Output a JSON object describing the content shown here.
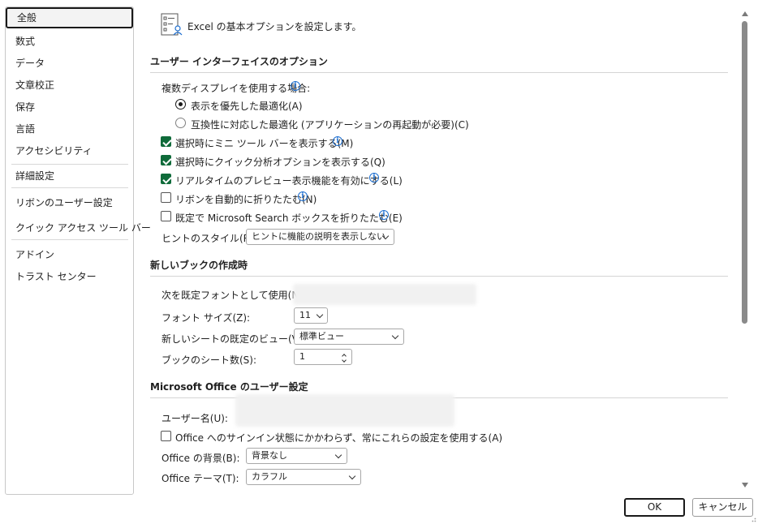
{
  "sidebar": {
    "items": [
      {
        "label": "全般"
      },
      {
        "label": "数式"
      },
      {
        "label": "データ"
      },
      {
        "label": "文章校正"
      },
      {
        "label": "保存"
      },
      {
        "label": "言語"
      },
      {
        "label": "アクセシビリティ"
      },
      {
        "label": "詳細設定"
      },
      {
        "label": "リボンのユーザー設定"
      },
      {
        "label": "クイック アクセス ツール バー"
      },
      {
        "label": "アドイン"
      },
      {
        "label": "トラスト センター"
      }
    ]
  },
  "header": {
    "title": "Excel の基本オプションを設定します。",
    "icon": "options-list-icon"
  },
  "ui_section": {
    "title": "ユーザー インターフェイスのオプション",
    "multi_display_label": "複数ディスプレイを使用する場合:",
    "radio_display": "表示を優先した最適化(A)",
    "radio_compat": "互換性に対応した最適化 (アプリケーションの再起動が必要)(C)",
    "mini_toolbar": "選択時にミニ ツール バーを表示する(M)",
    "quick_analysis": "選択時にクイック分析オプションを表示する(Q)",
    "live_preview": "リアルタイムのプレビュー表示機能を有効にする(L)",
    "collapse_ribbon": "リボンを自動的に折りたたむ(N)",
    "collapse_search": "既定で Microsoft Search ボックスを折りたたむ(E)",
    "tooltip_label": "ヒントのスタイル(R):",
    "tooltip_value": "ヒントに機能の説明を表示しない"
  },
  "book_section": {
    "title": "新しいブックの作成時",
    "font_label": "次を既定フォントとして使用(N):",
    "size_label": "フォント サイズ(Z):",
    "size_value": "11",
    "view_label": "新しいシートの既定のビュー(V):",
    "view_value": "標準ビュー",
    "sheets_label": "ブックのシート数(S):",
    "sheets_value": "1"
  },
  "user_section": {
    "title": "Microsoft Office のユーザー設定",
    "username_label": "ユーザー名(U):",
    "always_use": "Office へのサインイン状態にかかわらず、常にこれらの設定を使用する(A)",
    "background_label": "Office の背景(B):",
    "background_value": "背景なし",
    "theme_label": "Office テーマ(T):",
    "theme_value": "カラフル"
  },
  "footer": {
    "ok_label": "OK",
    "cancel_label": "キャンセル"
  },
  "colors": {
    "accent_check": "#0f6b3a",
    "info": "#1e6fd0"
  }
}
